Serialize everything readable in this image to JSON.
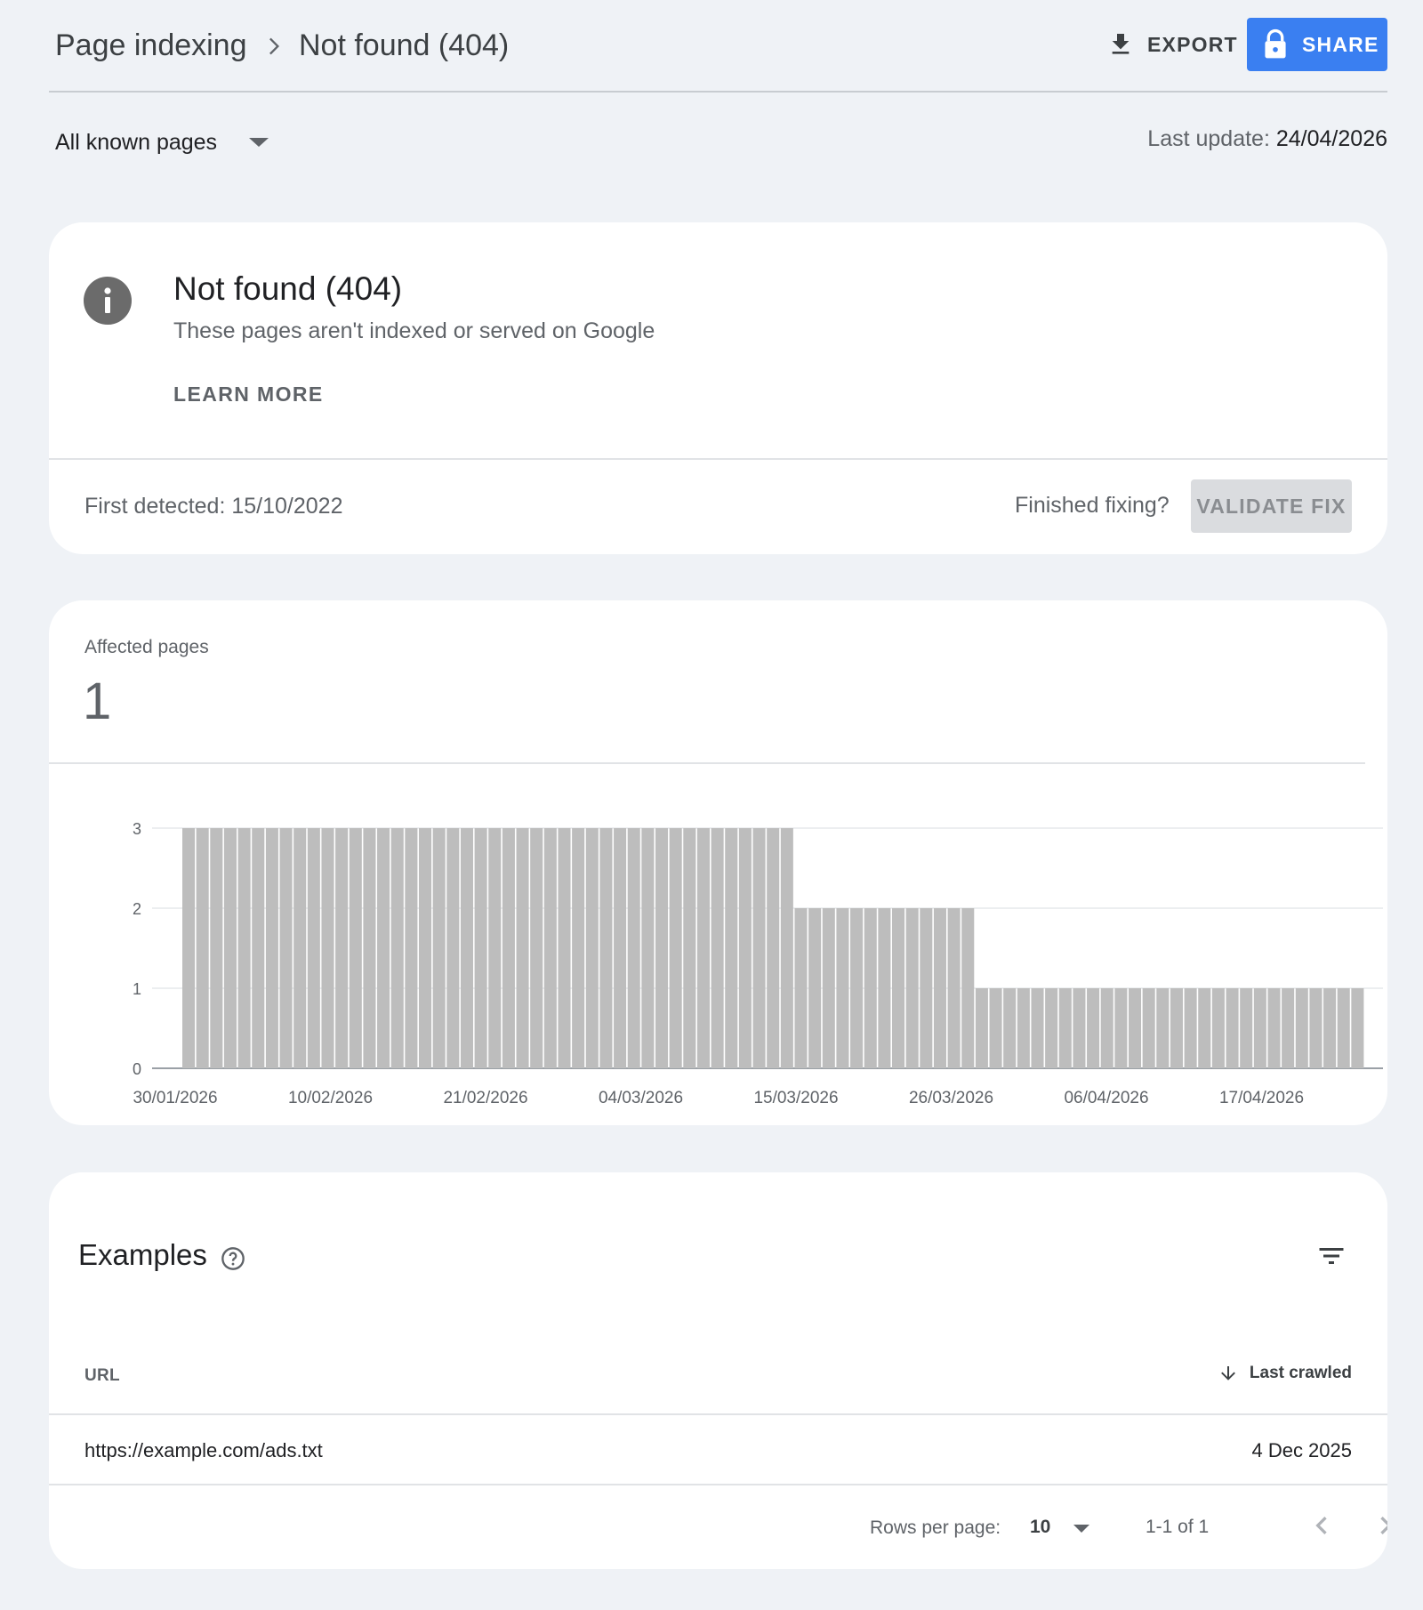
{
  "header": {
    "breadcrumb_root": "Page indexing",
    "breadcrumb_current": "Not found (404)",
    "export_label": "EXPORT",
    "share_label": "SHARE"
  },
  "filter": {
    "selected": "All known pages"
  },
  "last_update": {
    "label": "Last update:",
    "value": "24/04/2026"
  },
  "issue": {
    "title": "Not found (404)",
    "subtitle": "These pages aren't indexed or served on Google",
    "learn_more": "LEARN MORE",
    "first_detected": "First detected: 15/10/2022",
    "finished_fixing": "Finished fixing?",
    "validate_fix": "VALIDATE FIX"
  },
  "affected": {
    "label": "Affected pages",
    "value": "1"
  },
  "chart_data": {
    "type": "bar",
    "x_tick_labels": [
      "30/01/2026",
      "10/02/2026",
      "21/02/2026",
      "04/03/2026",
      "15/03/2026",
      "26/03/2026",
      "06/04/2026",
      "17/04/2026"
    ],
    "y_ticks": [
      0,
      1,
      2,
      3
    ],
    "ylim": [
      0,
      3
    ],
    "grid": true,
    "bar_color": "#bdbdbd",
    "series": [
      {
        "values": [
          3,
          3,
          3,
          3,
          3,
          3,
          3,
          3,
          3,
          3,
          3,
          3,
          3,
          3,
          3,
          3,
          3,
          3,
          3,
          3,
          3,
          3,
          3,
          3,
          3,
          3,
          3,
          3,
          3,
          3,
          3,
          3,
          3,
          3,
          3,
          3,
          3,
          3,
          3,
          3,
          3,
          3,
          3,
          3,
          2,
          2,
          2,
          2,
          2,
          2,
          2,
          2,
          2,
          2,
          2,
          2,
          2,
          1,
          1,
          1,
          1,
          1,
          1,
          1,
          1,
          1,
          1,
          1,
          1,
          1,
          1,
          1,
          1,
          1,
          1,
          1,
          1,
          1,
          1,
          1,
          1,
          1,
          1,
          1,
          1
        ]
      }
    ]
  },
  "examples": {
    "title": "Examples",
    "columns": {
      "url": "URL",
      "last_crawled": "Last crawled"
    },
    "rows": [
      {
        "url": "https://example.com/ads.txt",
        "last_crawled": "4 Dec 2025"
      }
    ],
    "pagination": {
      "rows_per_page_label": "Rows per page:",
      "rows_per_page_value": "10",
      "range": "1-1 of 1"
    }
  },
  "colors": {
    "background": "#eff2f6",
    "accent": "#3a7ff1",
    "bar": "#bdbdbd"
  }
}
